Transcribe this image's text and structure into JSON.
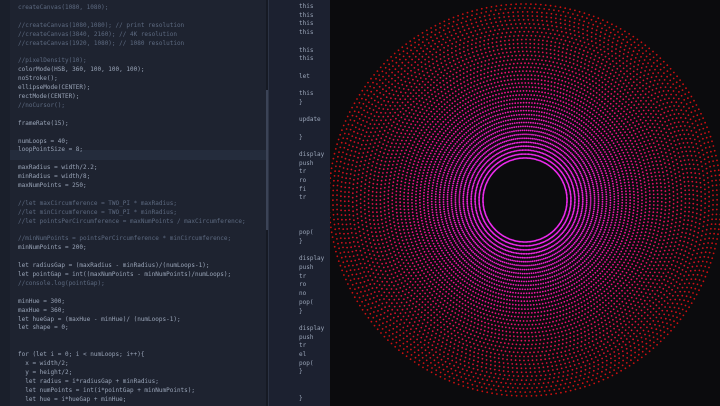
{
  "editor_left": {
    "lines": [
      {
        "text": "createCanvas(1080, 1080);",
        "cls": "comment"
      },
      {
        "text": "",
        "cls": ""
      },
      {
        "text": "//createCanvas(1080,1080); // print resolution",
        "cls": "comment"
      },
      {
        "text": "//createCanvas(3840, 2160); // 4K resolution",
        "cls": "comment"
      },
      {
        "text": "//createCanvas(1920, 1080); // 1080 resolution",
        "cls": "comment"
      },
      {
        "text": "",
        "cls": ""
      },
      {
        "text": "//pixelDensity(10);",
        "cls": "comment"
      },
      {
        "text": "colorMode(HSB, 360, 100, 100, 100);",
        "cls": ""
      },
      {
        "text": "noStroke();",
        "cls": ""
      },
      {
        "text": "ellipseMode(CENTER);",
        "cls": ""
      },
      {
        "text": "rectMode(CENTER);",
        "cls": ""
      },
      {
        "text": "//noCursor();",
        "cls": "comment"
      },
      {
        "text": "",
        "cls": ""
      },
      {
        "text": "frameRate(15);",
        "cls": ""
      },
      {
        "text": "",
        "cls": ""
      },
      {
        "text": "numLoops = 40;",
        "cls": ""
      },
      {
        "text": "loopPointSize = 8;",
        "cls": ""
      },
      {
        "text": "",
        "cls": ""
      },
      {
        "text": "maxRadius = width/2.2;",
        "cls": ""
      },
      {
        "text": "minRadius = width/8;",
        "cls": ""
      },
      {
        "text": "maxNumPoints = 250;",
        "cls": ""
      },
      {
        "text": "",
        "cls": ""
      },
      {
        "text": "//let maxCircumference = TWO_PI * maxRadius;",
        "cls": "comment"
      },
      {
        "text": "//let minCircumference = TWO_PI * minRadius;",
        "cls": "comment"
      },
      {
        "text": "//let pointsPerCircumference = maxNumPoints / maxCircumference;",
        "cls": "comment"
      },
      {
        "text": "",
        "cls": ""
      },
      {
        "text": "//minNumPoints = pointsPerCircumference * minCircumference;",
        "cls": "comment"
      },
      {
        "text": "minNumPoints = 200;",
        "cls": ""
      },
      {
        "text": "",
        "cls": ""
      },
      {
        "text": "let radiusGap = (maxRadius - minRadius)/(numLoops-1);",
        "cls": ""
      },
      {
        "text": "let pointGap = int((maxNumPoints - minNumPoints)/numLoops);",
        "cls": ""
      },
      {
        "text": "//console.log(pointGap);",
        "cls": "comment"
      },
      {
        "text": "",
        "cls": ""
      },
      {
        "text": "minHue = 300;",
        "cls": ""
      },
      {
        "text": "maxHue = 360;",
        "cls": ""
      },
      {
        "text": "let hueGap = (maxHue - minHue)/ (numLoops-1);",
        "cls": ""
      },
      {
        "text": "let shape = 0;",
        "cls": ""
      },
      {
        "text": "",
        "cls": ""
      },
      {
        "text": "",
        "cls": ""
      },
      {
        "text": "for (let i = 0; i < numLoops; i++){",
        "cls": ""
      },
      {
        "text": "  x = width/2;",
        "cls": ""
      },
      {
        "text": "  y = height/2;",
        "cls": ""
      },
      {
        "text": "  let radius = i*radiusGap + minRadius;",
        "cls": ""
      },
      {
        "text": "  let numPoints = int(i*pointGap + minNumPoints);",
        "cls": ""
      },
      {
        "text": "  let hue = i*hueGap + minHue;",
        "cls": ""
      }
    ]
  },
  "editor_right": {
    "lines": [
      {
        "text": "this"
      },
      {
        "text": "this"
      },
      {
        "text": "this"
      },
      {
        "text": "this"
      },
      {
        "text": ""
      },
      {
        "text": "this"
      },
      {
        "text": "this"
      },
      {
        "text": ""
      },
      {
        "text": "let"
      },
      {
        "text": ""
      },
      {
        "text": "this"
      },
      {
        "text": "}"
      },
      {
        "text": ""
      },
      {
        "text": "update"
      },
      {
        "text": ""
      },
      {
        "text": "}"
      },
      {
        "text": ""
      },
      {
        "text": "display"
      },
      {
        "text": "push"
      },
      {
        "text": "tr"
      },
      {
        "text": "ro"
      },
      {
        "text": "fi"
      },
      {
        "text": "tr"
      },
      {
        "text": ""
      },
      {
        "text": ""
      },
      {
        "text": ""
      },
      {
        "text": "pop("
      },
      {
        "text": "}"
      },
      {
        "text": ""
      },
      {
        "text": "display"
      },
      {
        "text": "push"
      },
      {
        "text": "tr"
      },
      {
        "text": "ro"
      },
      {
        "text": "no"
      },
      {
        "text": "pop("
      },
      {
        "text": "}"
      },
      {
        "text": ""
      },
      {
        "text": "display"
      },
      {
        "text": "push"
      },
      {
        "text": "tr"
      },
      {
        "text": "el"
      },
      {
        "text": "pop("
      },
      {
        "text": "}"
      },
      {
        "text": ""
      },
      {
        "text": ""
      },
      {
        "text": "}"
      }
    ]
  },
  "canvas": {
    "background": "#0b0b0d",
    "num_loops": 40,
    "min_hue": 300,
    "max_hue": 360,
    "min_points": 200,
    "max_points": 250
  }
}
